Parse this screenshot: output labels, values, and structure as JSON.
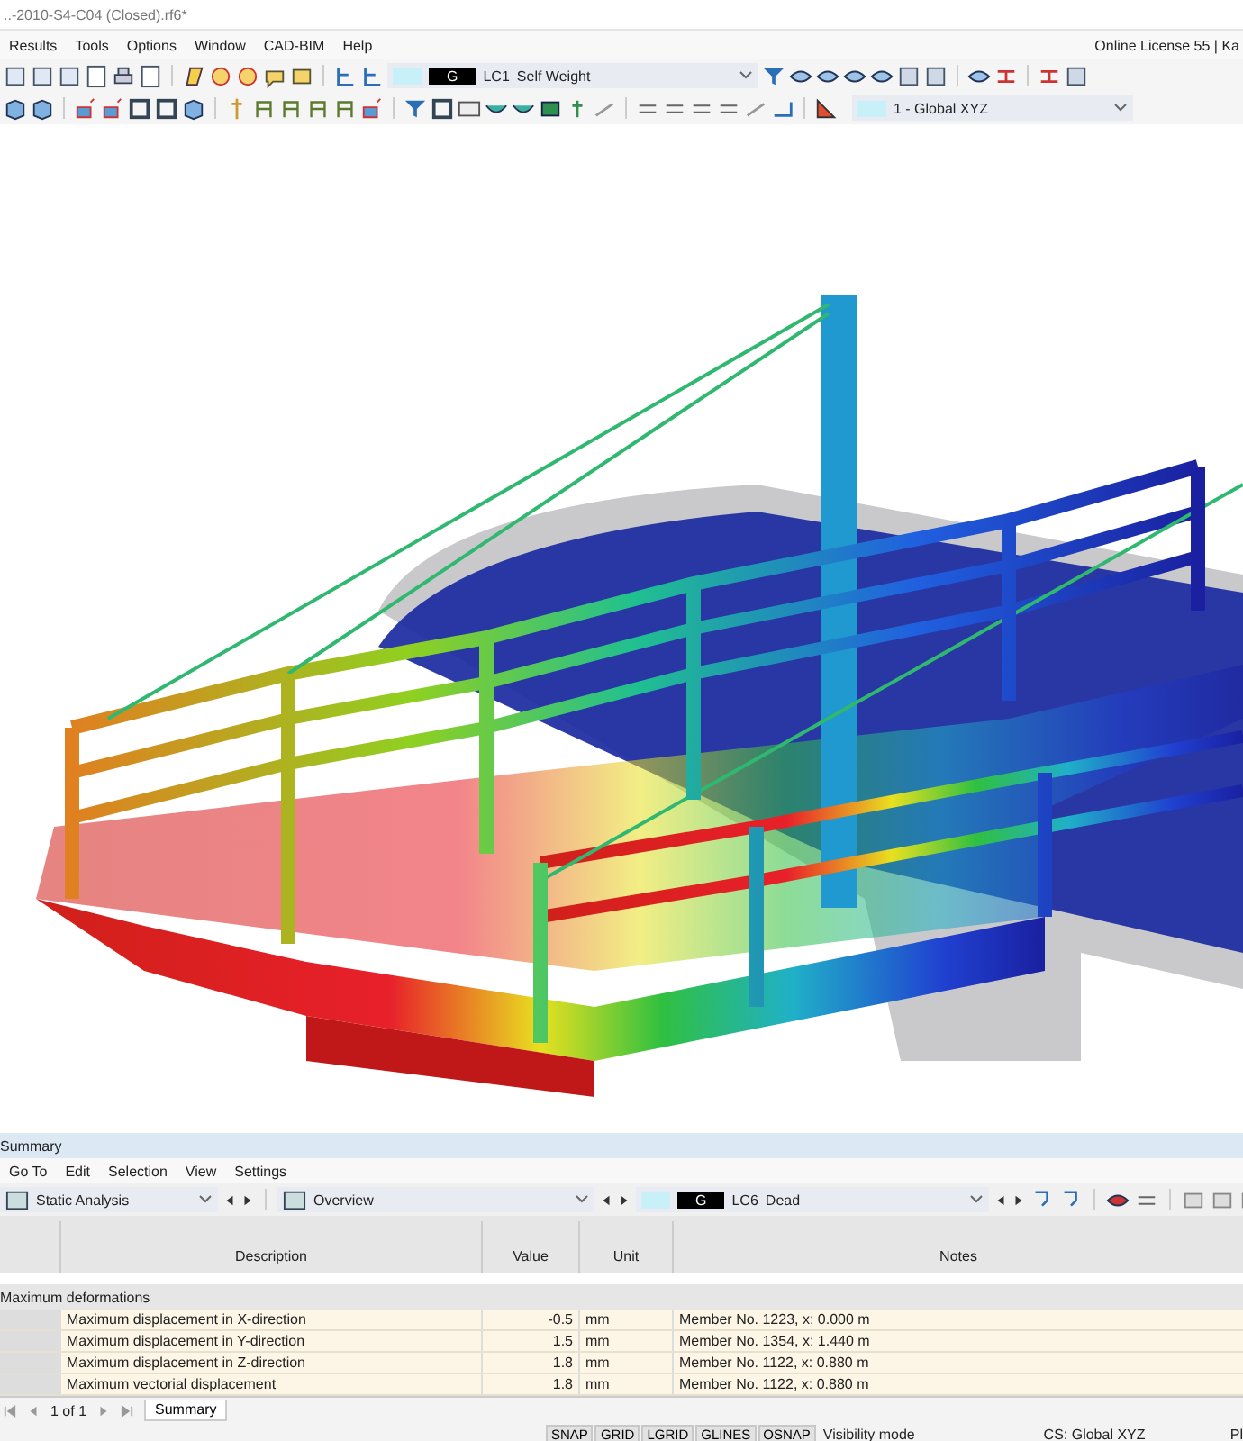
{
  "window": {
    "title": "..-2010-S4-C04 (Closed).rf6*"
  },
  "menu": [
    {
      "label": "Results"
    },
    {
      "label": "Tools"
    },
    {
      "label": "Options"
    },
    {
      "label": "Window"
    },
    {
      "label": "CAD-BIM"
    },
    {
      "label": "Help"
    }
  ],
  "license": "Online License 55 | Ka",
  "load_case": {
    "color": "#c8f0f8",
    "type": "G",
    "number": "LC1",
    "name": "Self Weight"
  },
  "view_selector": {
    "color": "#c8f0f8",
    "label": "1 - Global XYZ"
  },
  "panel": {
    "title": "Summary",
    "menu": [
      {
        "label": "Go To"
      },
      {
        "label": "Edit"
      },
      {
        "label": "Selection"
      },
      {
        "label": "View"
      },
      {
        "label": "Settings"
      }
    ],
    "analysis": "Static Analysis",
    "view": "Overview",
    "load_case": {
      "color": "#c8f0f8",
      "type": "G",
      "number": "LC6",
      "name": "Dead"
    },
    "columns": [
      "Description",
      "Value",
      "Unit",
      "Notes"
    ],
    "group": "Maximum deformations",
    "rows": [
      {
        "description": "Maximum displacement in X-direction",
        "value": "-0.5",
        "unit": "mm",
        "notes": "Member No. 1223, x: 0.000 m"
      },
      {
        "description": "Maximum displacement in Y-direction",
        "value": "1.5",
        "unit": "mm",
        "notes": "Member No. 1354, x: 1.440 m"
      },
      {
        "description": "Maximum displacement in Z-direction",
        "value": "1.8",
        "unit": "mm",
        "notes": "Member No. 1122, x: 0.880 m"
      },
      {
        "description": "Maximum vectorial displacement",
        "value": "1.8",
        "unit": "mm",
        "notes": "Member No. 1122, x: 0.880 m"
      }
    ],
    "pager": "1 of 1",
    "tabs": [
      {
        "label": "Summary",
        "selected": true
      }
    ]
  },
  "status_bar": {
    "toggles": [
      {
        "label": "SNAP",
        "on": true
      },
      {
        "label": "GRID",
        "on": true
      },
      {
        "label": "LGRID",
        "on": true
      },
      {
        "label": "GLINES",
        "on": true
      },
      {
        "label": "OSNAP",
        "on": true
      }
    ],
    "mode": "Visibility mode",
    "cs": "CS: Global XYZ",
    "plane": "Pl"
  }
}
